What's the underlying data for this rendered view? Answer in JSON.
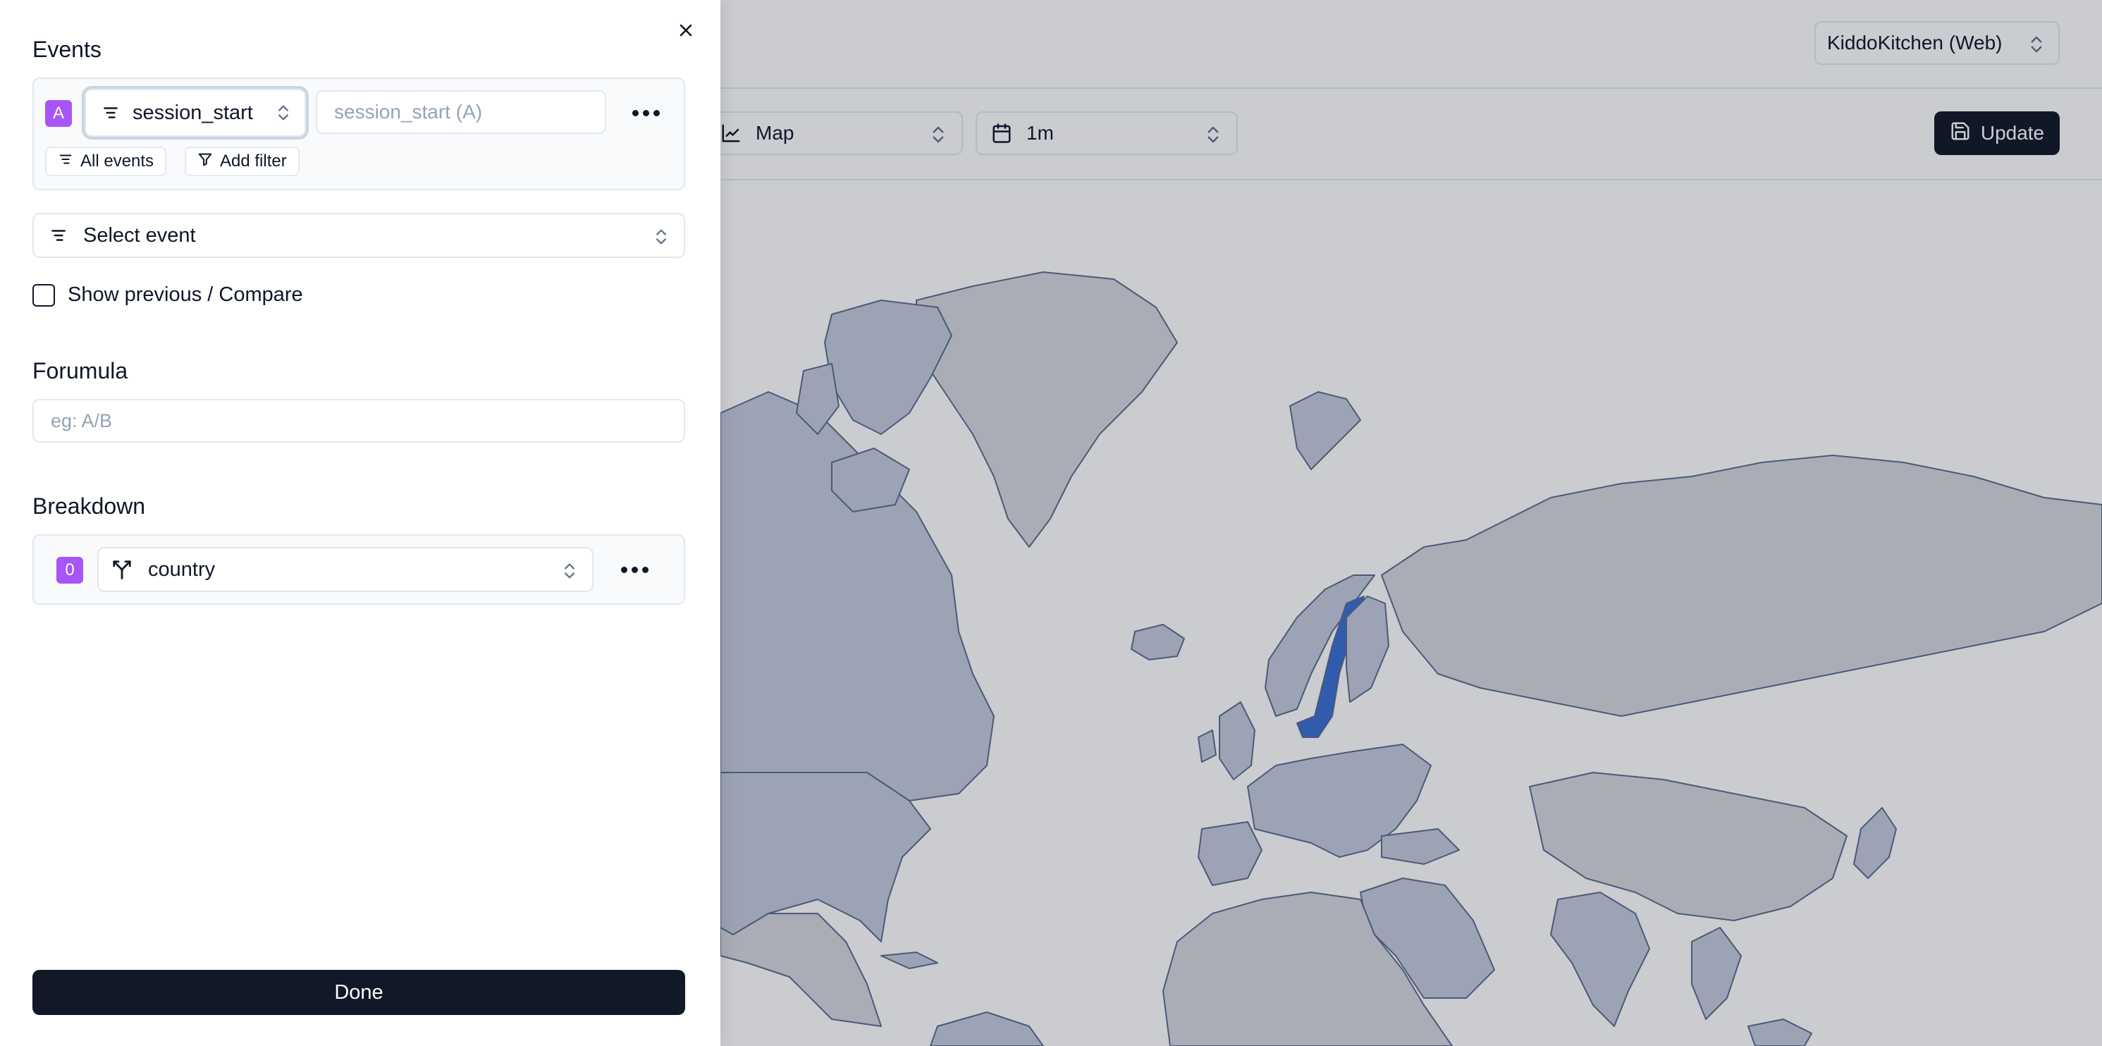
{
  "app": {
    "project_select": {
      "label": "KiddoKitchen (Web)"
    },
    "toolbar": {
      "chart_type": "Map",
      "range": "1m",
      "update_label": "Update"
    },
    "map": {
      "base_fill": "#c4cbdc",
      "country_stroke": "#5d6d8e",
      "highlight_fill": "#3b6fd1",
      "highlight_country": "Sweden"
    }
  },
  "drawer": {
    "events_title": "Events",
    "event": {
      "badge": "A",
      "name": "session_start",
      "alias_placeholder": "session_start (A)",
      "all_events_label": "All events",
      "add_filter_label": "Add filter"
    },
    "select_event_label": "Select event",
    "compare_label": "Show previous / Compare",
    "formula_title": "Forumula",
    "formula_placeholder": "eg: A/B",
    "breakdown_title": "Breakdown",
    "breakdown": {
      "badge": "0",
      "property": "country"
    },
    "done_label": "Done"
  },
  "colors": {
    "badge_purple": "#a855f7",
    "primary_dark": "#111827"
  }
}
